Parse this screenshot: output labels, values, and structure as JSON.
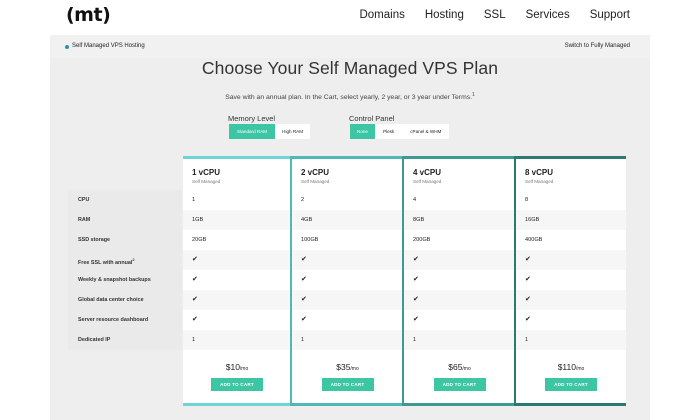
{
  "header": {
    "logo": "(mt)",
    "nav": [
      "Domains",
      "Hosting",
      "SSL",
      "Services",
      "Support"
    ]
  },
  "subbar": {
    "breadcrumb": "Self Managed VPS Hosting",
    "switch_link": "Switch to Fully Managed"
  },
  "page": {
    "title": "Choose Your Self Managed VPS Plan",
    "subtitle": "Save with an annual plan. In the Cart, select yearly, 2 year, or 3 year under Terms.",
    "subtitle_sup": "1"
  },
  "memory": {
    "label": "Memory Level",
    "options": [
      "Standard RAM",
      "High RAM"
    ],
    "selected": "Standard RAM"
  },
  "panel": {
    "label": "Control Panel",
    "options": [
      "None",
      "Plesk",
      "cPanel & WHM"
    ],
    "selected": "None"
  },
  "rows": {
    "cpu": "CPU",
    "ram": "RAM",
    "ssd": "SSD storage",
    "ssl": "Free SSL with annual",
    "ssl_sup": "2",
    "backups": "Weekly & snapshot backups",
    "datacenter": "Global data center choice",
    "dashboard": "Server resource dashboard",
    "ip": "Dedicated IP"
  },
  "plans": [
    {
      "name": "1 vCPU",
      "sub": "Self Managed",
      "cpu": "1",
      "ram": "1GB",
      "ssd": "20GB",
      "check": "✔",
      "ip": "1",
      "price": "$10",
      "per": "/mo",
      "button": "ADD TO CART"
    },
    {
      "name": "2 vCPU",
      "sub": "Self Managed",
      "cpu": "2",
      "ram": "4GB",
      "ssd": "100GB",
      "check": "✔",
      "ip": "1",
      "price": "$35",
      "per": "/mo",
      "button": "ADD TO CART"
    },
    {
      "name": "4 vCPU",
      "sub": "Self Managed",
      "cpu": "4",
      "ram": "8GB",
      "ssd": "200GB",
      "check": "✔",
      "ip": "1",
      "price": "$65",
      "per": "/mo",
      "button": "ADD TO CART"
    },
    {
      "name": "8 vCPU",
      "sub": "Self Managed",
      "cpu": "8",
      "ram": "16GB",
      "ssd": "400GB",
      "check": "✔",
      "ip": "1",
      "price": "$110",
      "per": "/mo",
      "button": "ADD TO CART"
    }
  ],
  "colors": {
    "accent": "#3cc6a4",
    "bar1": "#6fd3d8",
    "bar2": "#52b8b7",
    "bar3": "#3d9a93",
    "bar4": "#2a7a73"
  }
}
